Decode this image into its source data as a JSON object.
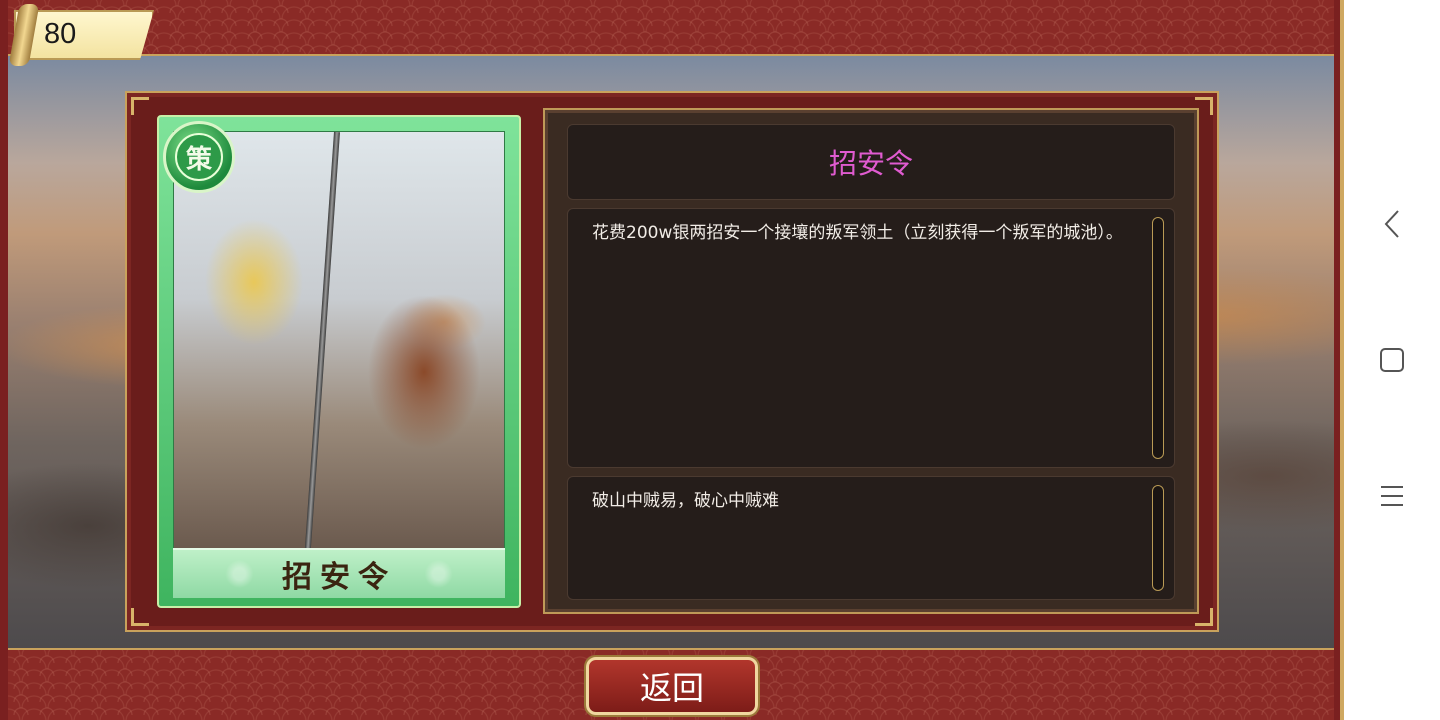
{
  "header": {
    "level_value": "80"
  },
  "card": {
    "emblem_glyph": "策",
    "name": "招安令",
    "rarity_color": "#3fb45f"
  },
  "details": {
    "title": "招安令",
    "title_color": "#e05bd0",
    "description": "花费200w银两招安一个接壤的叛军领土（立刻获得一个叛军的城池）。",
    "flavor_text": "破山中贼易，破心中贼难"
  },
  "footer": {
    "back_label": "返回"
  },
  "system_nav": {
    "icons": [
      "back-triangle-icon",
      "home-square-icon",
      "menu-lines-icon"
    ]
  }
}
